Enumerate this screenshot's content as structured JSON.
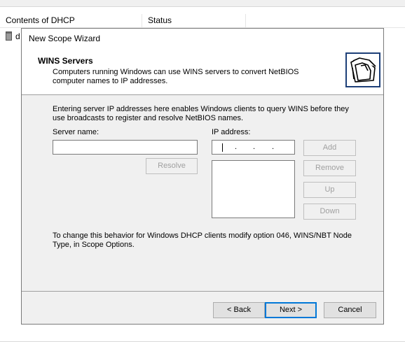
{
  "background_list": {
    "columns": [
      "Contents of DHCP",
      "Status"
    ],
    "row_text": "d"
  },
  "wizard": {
    "title": "New Scope Wizard",
    "header": {
      "title": "WINS Servers",
      "subtitle": "Computers running Windows can use WINS servers to convert NetBIOS computer names to IP addresses.",
      "icon": "folders-icon"
    },
    "intro": "Entering server IP addresses here enables Windows clients to query WINS before they use broadcasts to register and resolve NetBIOS names.",
    "server_name": {
      "label": "Server name:",
      "value": ""
    },
    "resolve_button": "Resolve",
    "ip_address": {
      "label": "IP address:",
      "separator": "."
    },
    "buttons": {
      "add": "Add",
      "remove": "Remove",
      "up": "Up",
      "down": "Down"
    },
    "note": "To change this behavior for Windows DHCP clients modify option 046, WINS/NBT Node Type, in Scope Options.",
    "footer": {
      "back": "< Back",
      "next": "Next >",
      "cancel": "Cancel"
    }
  }
}
